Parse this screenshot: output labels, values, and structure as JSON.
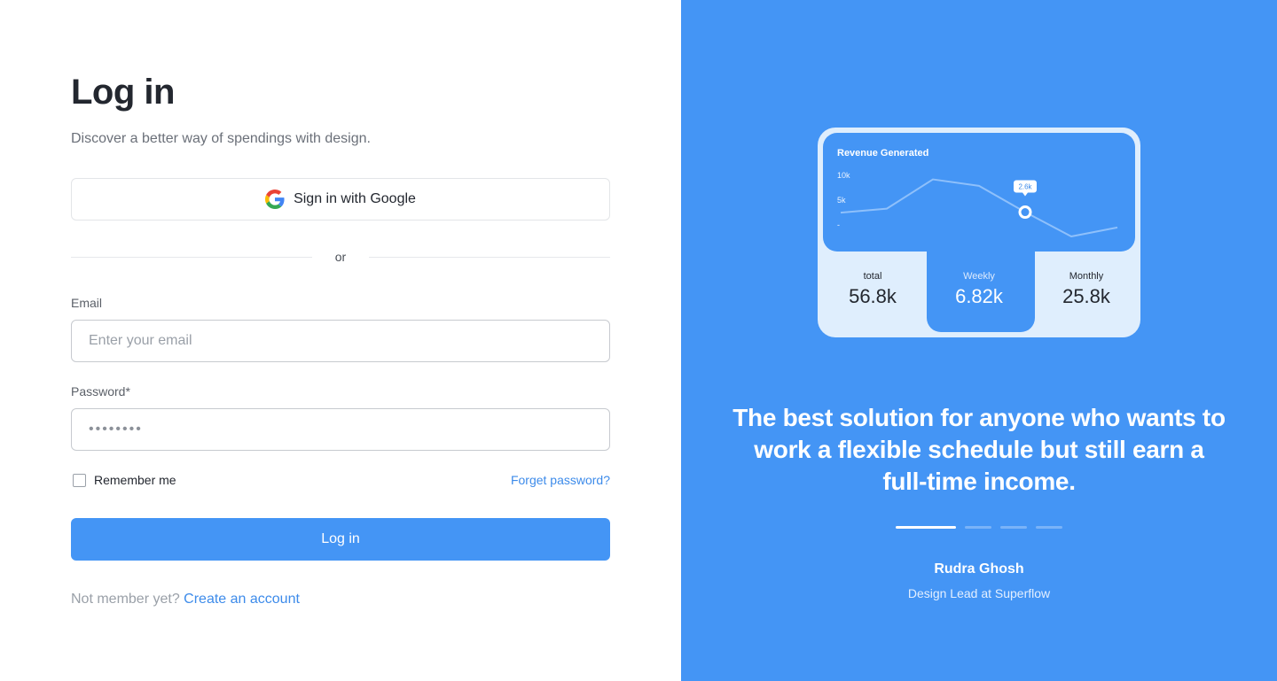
{
  "login": {
    "title": "Log in",
    "subtitle": "Discover a better way of spendings with design.",
    "google_label": "Sign in with Google",
    "divider_text": "or",
    "email_label": "Email",
    "email_placeholder": "Enter your email",
    "password_label": "Password*",
    "password_value": "••••••••",
    "remember_label": "Remember me",
    "forgot_label": "Forget password?",
    "login_button": "Log in",
    "signup_prompt": "Not member yet?",
    "signup_link": "Create an account"
  },
  "promo": {
    "card": {
      "chart_title": "Revenue Generated",
      "y_ticks": [
        "10k",
        "5k",
        "-"
      ],
      "tooltip": "2.6k",
      "stats": [
        {
          "label": "total",
          "value": "56.8k"
        },
        {
          "label": "Weekly",
          "value": "6.82k"
        },
        {
          "label": "Monthly",
          "value": "25.8k"
        }
      ]
    },
    "quote": "The best solution for anyone who wants to work a flexible schedule but still earn a full-time income.",
    "author": "Rudra Ghosh",
    "role": "Design Lead at Superflow",
    "slides_total": 4,
    "active_slide": 1
  },
  "chart_data": {
    "type": "line",
    "title": "Revenue Generated",
    "yticks": [
      "10k",
      "5k",
      "-"
    ],
    "values": [
      3.2,
      4.0,
      9.9,
      8.6,
      3.3,
      -1.6,
      0.2
    ],
    "highlight_index": 4,
    "highlight_label": "2.6k",
    "ylim": [
      0,
      10
    ]
  },
  "colors": {
    "accent": "#4495f5",
    "link": "#3d8bea",
    "card_bg": "#dfeefd"
  }
}
